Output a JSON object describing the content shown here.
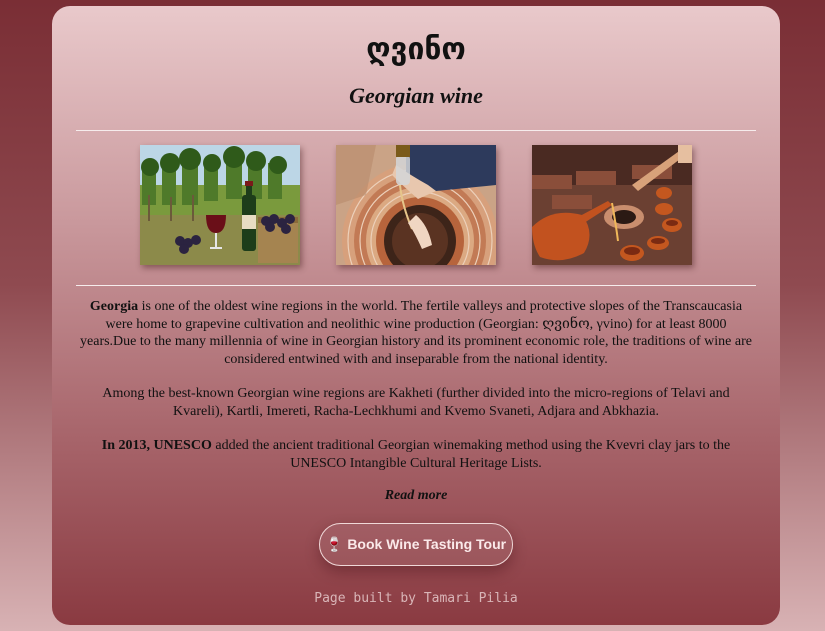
{
  "header": {
    "title_georgian": "ღვინო",
    "title_english": "Georgian wine"
  },
  "gallery": {
    "images": [
      {
        "name": "vineyard-photo"
      },
      {
        "name": "kvevri-pour-photo"
      },
      {
        "name": "clay-vessels-photo"
      }
    ]
  },
  "content": {
    "p1_bold": "Georgia",
    "p1_text": " is one of the oldest wine regions in the world. The fertile valleys and protective slopes of the Transcaucasia were home to grapevine cultivation and neolithic wine production (Georgian: ღვინო, γvino) for at least 8000 years.Due to the many millennia of wine in Georgian history and its prominent economic role, the traditions of wine are considered entwined with and inseparable from the national identity.",
    "p2_text": "Among the best-known Georgian wine regions are Kakheti (further divided into the micro-regions of Telavi and Kvareli), Kartli, Imereti, Racha-Lechkhumi and Kvemo Svaneti, Adjara and Abkhazia.",
    "p3_bold": "In 2013, UNESCO",
    "p3_text": " added the ancient traditional Georgian winemaking method using the Kvevri clay jars to the UNESCO Intangible Cultural Heritage Lists.",
    "read_more": "Read more"
  },
  "cta": {
    "icon": "wine-glass-icon",
    "glyph": "🍷",
    "label": "Book Wine Tasting Tour"
  },
  "footer": {
    "text": "Page built by Tamari Pilia"
  },
  "colors": {
    "background_top": "#7a2e35",
    "card_top": "#e9c9cb",
    "card_bottom": "#8a3a41",
    "footer_text": "#d9b6b8"
  }
}
